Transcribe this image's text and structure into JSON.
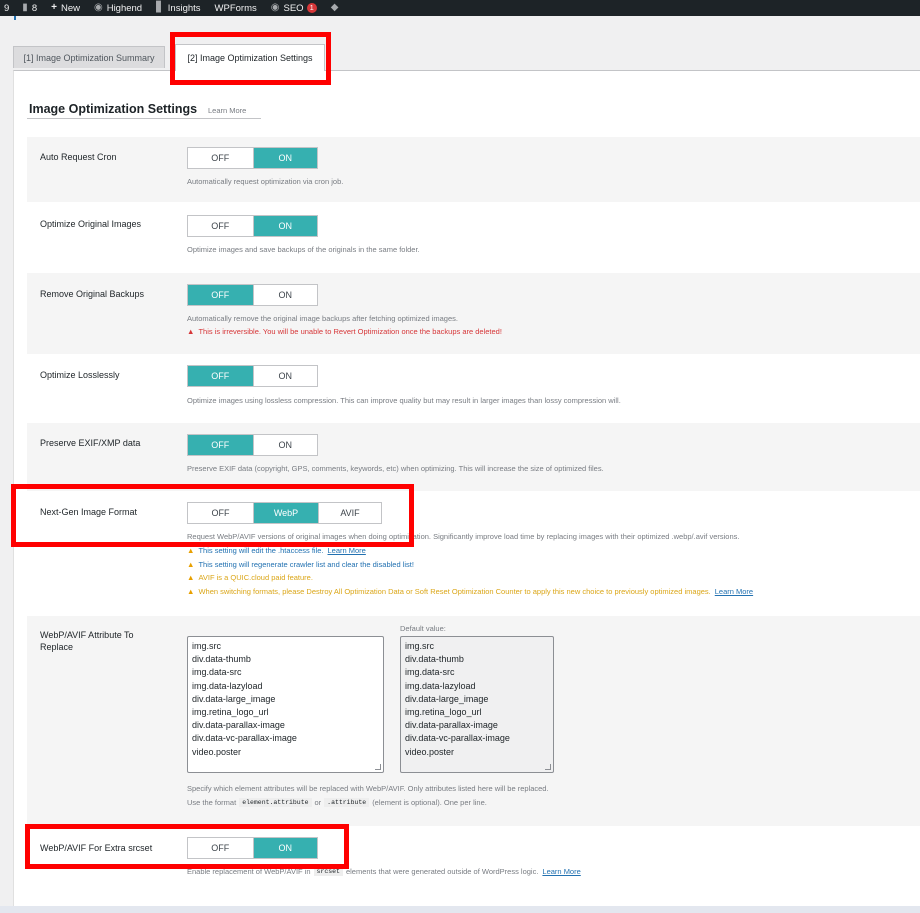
{
  "admin_bar": {
    "updates_count": "9",
    "comments_count": "8",
    "new_label": "New",
    "site_name": "Highend",
    "insights_label": "Insights",
    "wpforms_label": "WPForms",
    "seo_label": "SEO",
    "seo_badge": "1"
  },
  "tabs": [
    {
      "label": "[1] Image Optimization Summary",
      "active": false
    },
    {
      "label": "[2] Image Optimization Settings",
      "active": true
    }
  ],
  "section": {
    "title": "Image Optimization Settings",
    "learn_more": "Learn More"
  },
  "settings": {
    "auto_request_cron": {
      "label": "Auto Request Cron",
      "options": [
        "OFF",
        "ON"
      ],
      "selected": "ON",
      "description": "Automatically request optimization via cron job."
    },
    "optimize_original": {
      "label": "Optimize Original Images",
      "options": [
        "OFF",
        "ON"
      ],
      "selected": "ON",
      "description": "Optimize images and save backups of the originals in the same folder."
    },
    "remove_backups": {
      "label": "Remove Original Backups",
      "options": [
        "OFF",
        "ON"
      ],
      "selected": "OFF",
      "description": "Automatically remove the original image backups after fetching optimized images.",
      "warning": "This is irreversible. You will be unable to Revert Optimization once the backups are deleted!"
    },
    "optimize_losslessly": {
      "label": "Optimize Losslessly",
      "options": [
        "OFF",
        "ON"
      ],
      "selected": "OFF",
      "description": "Optimize images using lossless compression. This can improve quality but may result in larger images than lossy compression will."
    },
    "preserve_exif": {
      "label": "Preserve EXIF/XMP data",
      "options": [
        "OFF",
        "ON"
      ],
      "selected": "OFF",
      "description": "Preserve EXIF data (copyright, GPS, comments, keywords, etc) when optimizing. This will increase the size of optimized files."
    },
    "next_gen_format": {
      "label": "Next-Gen Image Format",
      "options": [
        "OFF",
        "WebP",
        "AVIF"
      ],
      "selected": "WebP",
      "description": "Request WebP/AVIF versions of original images when doing optimization. Significantly improve load time by replacing images with their optimized .webp/.avif versions.",
      "notes": [
        {
          "text": "This setting will edit the .htaccess file.",
          "link": "Learn More"
        },
        {
          "text": "This setting will regenerate crawler list and clear the disabled list!"
        },
        {
          "text": "AVIF is a QUIC.cloud paid feature."
        },
        {
          "text": "When switching formats, please Destroy All Optimization Data or Soft Reset Optimization Counter to apply this new choice to previously optimized images.",
          "link": "Learn More"
        }
      ]
    },
    "attribute_replace": {
      "label_line1": "WebP/AVIF Attribute To",
      "label_line2": "Replace",
      "default_label": "Default value:",
      "values": [
        "img.src",
        "div.data-thumb",
        "img.data-src",
        "img.data-lazyload",
        "div.data-large_image",
        "img.retina_logo_url",
        "div.data-parallax-image",
        "div.data-vc-parallax-image",
        "video.poster"
      ],
      "defaults": [
        "img.src",
        "div.data-thumb",
        "img.data-src",
        "img.data-lazyload",
        "div.data-large_image",
        "img.retina_logo_url",
        "div.data-parallax-image",
        "div.data-vc-parallax-image",
        "video.poster"
      ],
      "description": "Specify which element attributes will be replaced with WebP/AVIF. Only attributes listed here will be replaced.",
      "format_prefix": "Use the format",
      "format_code1": "element.attribute",
      "format_or": "or",
      "format_code2": ".attribute",
      "format_suffix": "(element is optional). One per line."
    },
    "extra_srcset": {
      "label": "WebP/AVIF For Extra srcset",
      "options": [
        "OFF",
        "ON"
      ],
      "selected": "ON",
      "description_prefix": "Enable replacement of WebP/AVIF in",
      "description_code": "srcset",
      "description_suffix": "elements that were generated outside of WordPress logic.",
      "link": "Learn More"
    }
  },
  "colors": {
    "toggle_active": "#36b0b0",
    "highlight": "#ff0000",
    "warning_red": "#d63638",
    "note_blue": "#2271b1",
    "note_orange": "#dba617"
  }
}
